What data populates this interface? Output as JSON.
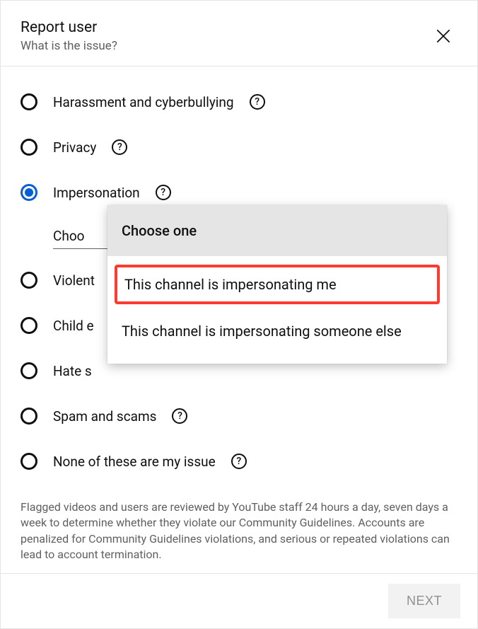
{
  "header": {
    "title": "Report user",
    "subtitle": "What is the issue?"
  },
  "options": [
    {
      "label": "Harassment and cyberbullying"
    },
    {
      "label": "Privacy"
    },
    {
      "label": "Impersonation"
    },
    {
      "label": "Violent"
    },
    {
      "label": "Child e"
    },
    {
      "label": "Hate s"
    },
    {
      "label": "Spam and scams"
    },
    {
      "label": "None of these are my issue"
    }
  ],
  "subselect": {
    "trigger": "Choo"
  },
  "dropdown": {
    "header": "Choose one",
    "items": [
      "This channel is impersonating me",
      "This channel is impersonating someone else"
    ]
  },
  "disclaimer": "Flagged videos and users are reviewed by YouTube staff 24 hours a day, seven days a week to determine whether they violate our Community Guidelines. Accounts are penalized for Community Guidelines violations, and serious or repeated violations can lead to account termination.",
  "footer": {
    "next": "NEXT"
  }
}
